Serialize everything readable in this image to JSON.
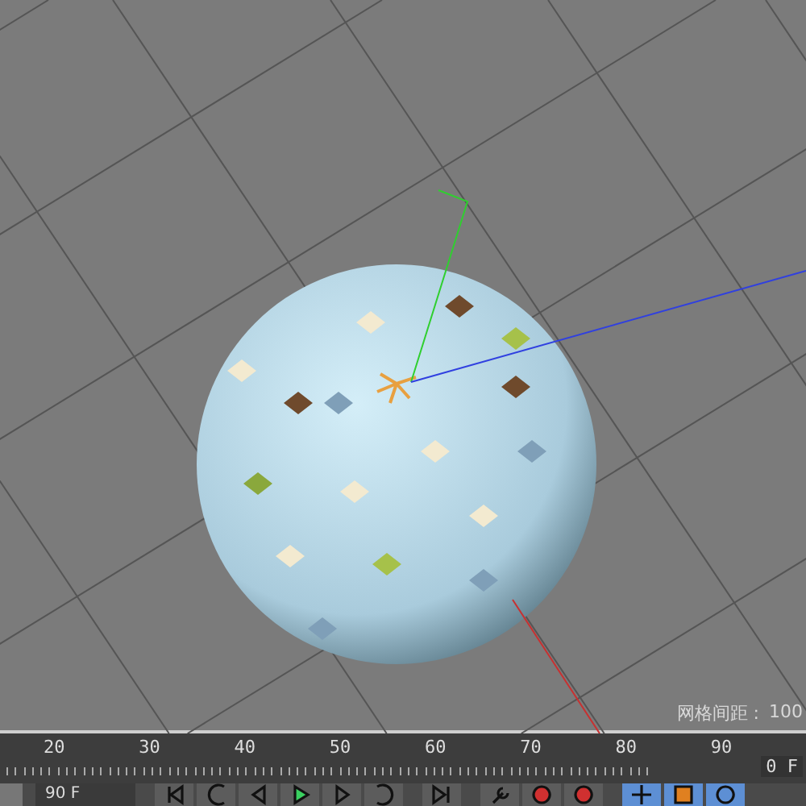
{
  "viewport": {
    "grid_spacing_label": "网格间距 :",
    "grid_spacing_value": "100"
  },
  "timeline": {
    "ticks": [
      "20",
      "30",
      "40",
      "50",
      "60",
      "70",
      "80",
      "90"
    ],
    "frame_field": "0 F"
  },
  "toolbar": {
    "frame_field": "90 F"
  }
}
